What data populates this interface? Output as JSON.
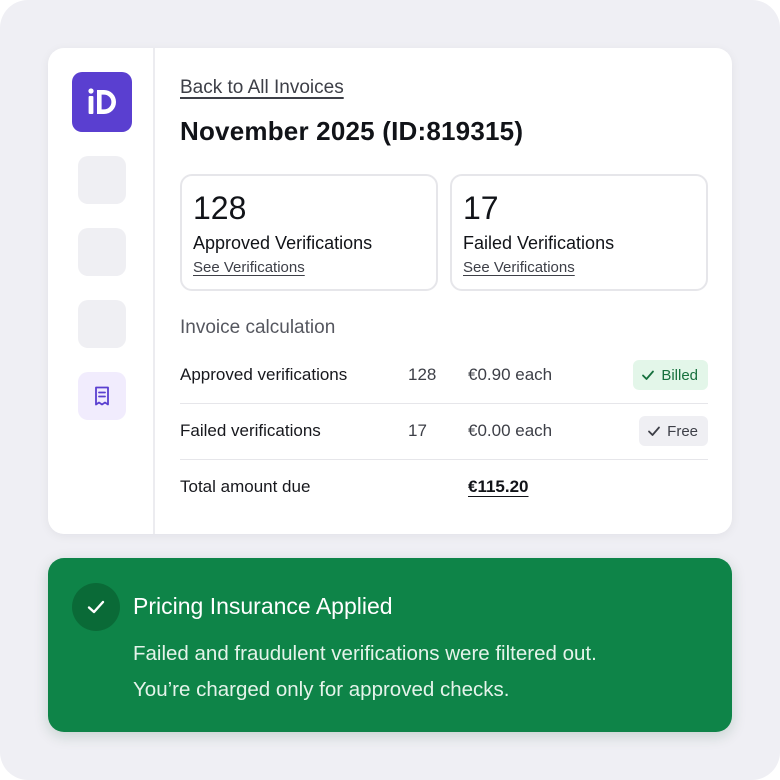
{
  "app": {
    "logo_text": "iD"
  },
  "sidebar": {
    "items": [
      {
        "name": "placeholder"
      },
      {
        "name": "placeholder"
      },
      {
        "name": "placeholder"
      },
      {
        "name": "invoices",
        "icon": "receipt-icon",
        "active": true
      }
    ]
  },
  "header": {
    "back_link": "Back to All Invoices",
    "title": "November 2025 (ID:819315)"
  },
  "stats": [
    {
      "value": "128",
      "label": "Approved Verifications",
      "link": "See Verifications"
    },
    {
      "value": "17",
      "label": "Failed Verifications",
      "link": "See Verifications"
    }
  ],
  "calculation": {
    "title": "Invoice calculation",
    "rows": [
      {
        "name": "Approved verifications",
        "qty": "128",
        "price": "€0.90 each",
        "badge": "Billed",
        "badge_color": "#16703d"
      },
      {
        "name": "Failed verifications",
        "qty": "17",
        "price": "€0.00 each",
        "badge": "Free",
        "badge_color": "#3d3f47"
      }
    ],
    "total_label": "Total amount due",
    "total_value": "€115.20"
  },
  "banner": {
    "title": "Pricing Insurance Applied",
    "line1": "Failed and fraudulent verifications were filtered out.",
    "line2": "You’re charged only for approved checks.",
    "color": "#0e8448"
  },
  "colors": {
    "brand": "#5a3fd0",
    "success": "#0e8448"
  }
}
